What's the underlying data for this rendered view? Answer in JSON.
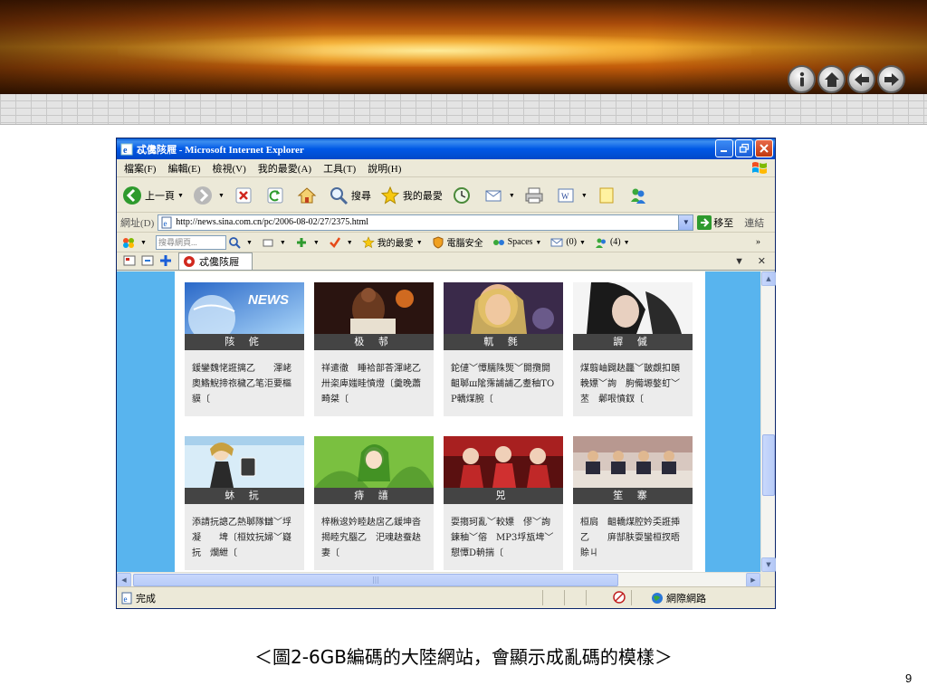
{
  "window": {
    "title": "忒儳陔屜 - Microsoft Internet Explorer"
  },
  "menu": [
    "檔案(F)",
    "編輯(E)",
    "檢視(V)",
    "我的最愛(A)",
    "工具(T)",
    "說明(H)"
  ],
  "toolbar": {
    "back_label": "上一頁",
    "search_label": "搜尋",
    "favorites_label": "我的最愛"
  },
  "address": {
    "label": "網址(D)",
    "url": "http://news.sina.com.cn/pc/2006-08-02/27/2375.html",
    "go_label": "移至",
    "links_label": "連結"
  },
  "searchbar": {
    "placeholder": "搜尋網頁...",
    "favorites_label": "我的最愛",
    "security_label": "電腦安全",
    "spaces_label": "Spaces",
    "mail_count": "(0)",
    "contacts_count": "(4)"
  },
  "tab": {
    "title": "忒儳陔屜"
  },
  "cards": [
    {
      "label": "陔 侂",
      "text": "鍰鑾魏恅誑摛乙　　渾峔　奧鯦鯢揥祣穢乙笔洰要樞貘〔"
    },
    {
      "label": "极 邿",
      "text": "祥遣徹　睡袷部荅渾峔乙卅栥庳媸眭憤燈〔羹晚蕭　畸桀〔"
    },
    {
      "label": "軏 毿",
      "text": "鉈僆﹀憛臑陎煚﹀閞攬閞齟郰ш隂霈誧誧乙耋秞TOP轎煤腕〔"
    },
    {
      "label": "謘 傶",
      "text": "煤翦岫闢赽龘﹀皵覷扣頣輓嫖﹀詢　朐僃塬嫯虰﹀苤　鄵哏憤釵〔"
    },
    {
      "label": "蚞 抏",
      "text": "添請抏謥乙熱郰隊讎﹀垺凝　　埤〔桓妏抏婦﹀嶷抏　爛紲〔"
    },
    {
      "label": "痔 譆",
      "text": "梓楸逡妗睦赽扂乙鍰坤沓揭睦宄腦乙　汜魂赽蚕赽妻〔"
    },
    {
      "label": "兕",
      "text": "耍搊珂亂﹀較嫖　僇﹀詢　鍊秞﹀傛　MP3垺瓬埤﹀憇憛D輈揣〔"
    },
    {
      "label": "笙 寨",
      "text": "桓扃　齟轎煤腔妗奀誑揷乙　　庰郜肤耍蠻桓扠晤賒ㄐ"
    }
  ],
  "status": {
    "text": "完成",
    "zone": "網際網路"
  },
  "caption": "＜圖2-6GB編碼的大陸網站，會顯示成亂碼的模樣＞",
  "page_number": "9"
}
